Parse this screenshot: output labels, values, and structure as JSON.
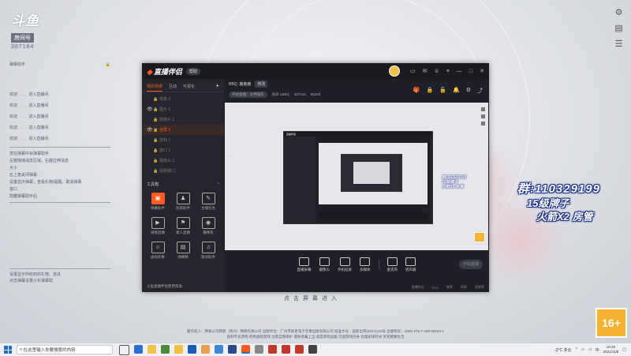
{
  "overlay": {
    "logo_main": "斗鱼",
    "logo_sub": "房间号",
    "room_number": "307164",
    "left_head_label": "弹幕助手",
    "messages": [
      {
        "prefix": "欢迎",
        "name": "......",
        "suffix": "进入直播间"
      },
      {
        "prefix": "欢迎",
        "name": "......",
        "suffix": "进入直播间"
      },
      {
        "prefix": "欢迎",
        "name": "......",
        "suffix": "进入直播间"
      },
      {
        "prefix": "欢迎",
        "name": "......",
        "suffix": "进入直播间"
      },
      {
        "prefix": "欢迎",
        "name": "......",
        "suffix": "进入直播间"
      }
    ],
    "notices": [
      "您在弹幕中会弹幕助手",
      "左键拖拽消息区域，右键拉伸消息",
      "大小",
      "右上角关闭弹幕",
      "设置显示弹幕，查看礼物/提醒，取消弹幕",
      "窗口",
      "隐藏弹幕助手后"
    ],
    "bottom_notices": [
      "设置显示你收到的礼物、道具",
      "点击弹幕设置小化弹幕助"
    ],
    "banner_line1": "群:110329199",
    "banner_line2": "15级牌子",
    "banner_line3": "火箭X2 房管",
    "enter_text": "点击屏幕进入",
    "age_badge": "16+",
    "copyright_lines": [
      "著作权人：网易公司网易（杭州）网络有限公司 出版单位：广州市新星电子音像出版有限公司 批准文号：国新出审[2021]123号 出版物号：ISBN 978-7-498-08184-1",
      "抵制不良游戏 拒绝盗版游戏 注意自我保护 谨防受骗上当 适度游戏益脑 沉迷游戏伤身 合理安排时间 享受健康生活"
    ]
  },
  "app": {
    "title": "直播伴侣",
    "title_badge": "帮助",
    "tabs": [
      "我的场景",
      "互动",
      "可视化"
    ],
    "scenes": [
      "场景 2",
      "图片 1",
      "摄像头 1",
      "全屏 1",
      "游戏 1",
      "窗口 1",
      "摄像头 2",
      "视频窗口"
    ],
    "active_scene_index": 3,
    "tools_label": "工具箱",
    "tools": [
      {
        "label": "弹幕助手",
        "icon": "▣",
        "hot": true
      },
      {
        "label": "房管助手",
        "icon": "♟",
        "hot": false
      },
      {
        "label": "主播任务",
        "icon": "✎",
        "hot": false
      },
      {
        "label": "视频直播",
        "icon": "▶",
        "hot": false
      },
      {
        "label": "素人直播",
        "icon": "⚑",
        "hot": false
      },
      {
        "label": "摄像机",
        "icon": "◉",
        "hot": false
      },
      {
        "label": "虚拟形象",
        "icon": "☺",
        "hot": false
      },
      {
        "label": "弹幕精",
        "icon": "▤",
        "hot": false
      },
      {
        "label": "歌词助手",
        "icon": "♫",
        "hot": false
      }
    ],
    "sidebar_footer": "斗鱼直播伴侣使用帮助",
    "room_label": "BBQ: 鹿鹿鹿",
    "room_tag": "修改",
    "sub_items": [
      "开始直播：大神操作",
      "房间 LBBQ",
      "307164",
      "55200"
    ],
    "controls": [
      "直播屏幕",
      "摄像头",
      "手机投屏",
      "多媒体",
      "麦克风",
      "扬声器"
    ],
    "start_label": "开始直播",
    "status_items": [
      "直播时长",
      "CPU",
      "帧率",
      "码率",
      "丢帧率"
    ]
  },
  "taskbar": {
    "search_placeholder": "在这里输入你要搜索的内容",
    "weather": "-2°C 多云",
    "time": "18:29",
    "date": "2021/11/8",
    "input_method": "中"
  },
  "colors": {
    "accent": "#ff5a1f",
    "badge": "#f5b331",
    "banner_stroke": "#1b2f8c"
  }
}
